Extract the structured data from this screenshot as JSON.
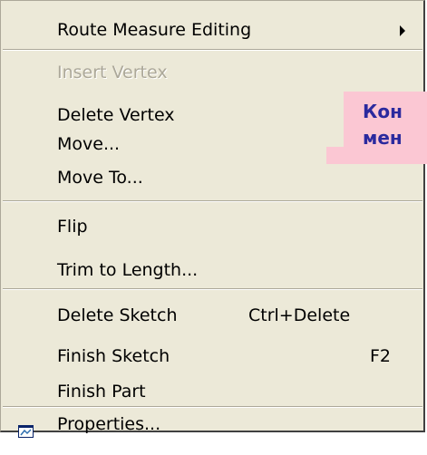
{
  "menu": {
    "items": [
      {
        "label": "Route Measure Editing",
        "has_submenu": true
      },
      {
        "label": "Insert Vertex",
        "disabled": true
      },
      {
        "label": "Delete Vertex"
      },
      {
        "label": "Move..."
      },
      {
        "label": "Move To..."
      },
      {
        "label": "Flip"
      },
      {
        "label": "Trim to Length..."
      },
      {
        "label": "Delete Sketch",
        "shortcut": "Ctrl+Delete"
      },
      {
        "label": "Finish Sketch",
        "shortcut": "F2"
      },
      {
        "label": "Finish Part"
      },
      {
        "label": "Properties...",
        "icon": "properties-icon"
      }
    ]
  },
  "callout": {
    "text": "Кон\nмен",
    "background": "#fbc7d3",
    "text_color": "#2b2a9e"
  },
  "colors": {
    "menu_background": "#ece9d8",
    "disabled_text": "#aca899"
  }
}
